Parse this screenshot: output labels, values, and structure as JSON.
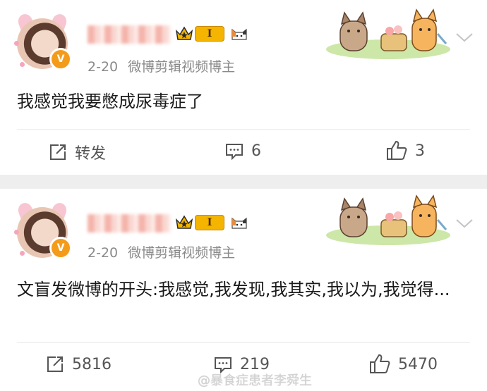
{
  "posts": [
    {
      "date": "2-20",
      "source": "微博剪辑视频博主",
      "level_badge": "I",
      "verified_badge": "V",
      "content": "我感觉我要憋成尿毒症了",
      "repost_label": "转发",
      "comments": "6",
      "likes": "3"
    },
    {
      "date": "2-20",
      "source": "微博剪辑视频博主",
      "level_badge": "I",
      "verified_badge": "V",
      "content": "文盲发微博的开头:我感觉,我发现,我其实,我以为,我觉得...",
      "repost_label": "5816",
      "comments": "219",
      "likes": "5470"
    }
  ],
  "watermark": "@暴食症患者李舜生",
  "colors": {
    "background": "#eeeeee",
    "card": "#ffffff",
    "meta_text": "#8a8a8a",
    "action_text": "#555555",
    "verified_orange": "#f49b1a",
    "level_gold": "#f4b400"
  }
}
